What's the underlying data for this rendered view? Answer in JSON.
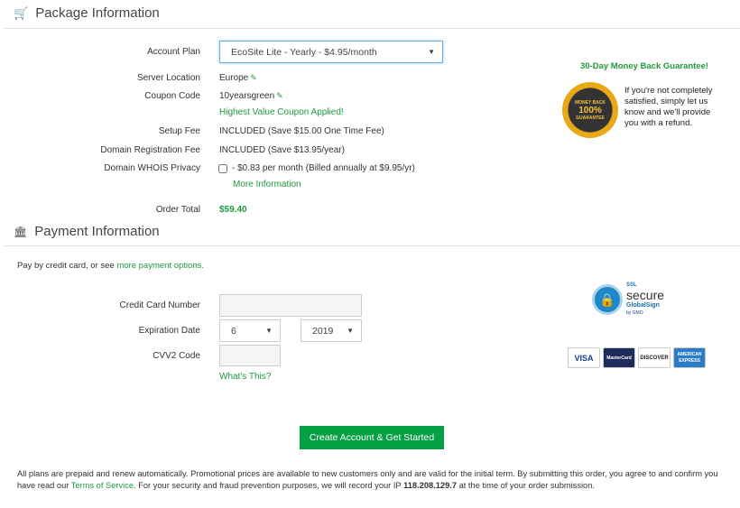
{
  "package": {
    "title": "Package Information",
    "icon": "shopping-cart-icon",
    "account_plan_label": "Account Plan",
    "account_plan_value": "EcoSite Lite - Yearly - $4.95/month",
    "server_location_label": "Server Location",
    "server_location_value": "Europe",
    "coupon_label": "Coupon Code",
    "coupon_value": "10yearsgreen",
    "coupon_message": "Highest Value Coupon Applied!",
    "setup_fee_label": "Setup Fee",
    "setup_fee_value": "INCLUDED (Save $15.00 One Time Fee)",
    "domain_reg_label": "Domain Registration Fee",
    "domain_reg_value": "INCLUDED (Save $13.95/year)",
    "whois_label": "Domain WHOIS Privacy",
    "whois_value": "- $0.83 per month (Billed annually at $9.95/yr)",
    "whois_checked": false,
    "more_info": "More Information",
    "order_total_label": "Order Total",
    "order_total_value": "$59.40"
  },
  "guarantee": {
    "title": "30-Day Money Back Guarantee!",
    "text": "If you're not completely satisfied, simply let us know and we'll provide you with a refund.",
    "badge_top": "MONEY BACK",
    "badge_mid": "100%",
    "badge_bottom": "GUARANTEE"
  },
  "payment": {
    "title": "Payment Information",
    "icon": "bank-icon",
    "intro": "Pay by credit card, or see ",
    "intro_link": "more payment options.",
    "cc_label": "Credit Card Number",
    "cc_value": "",
    "exp_label": "Expiration Date",
    "exp_month": "6",
    "exp_year": "2019",
    "cvv_label": "CVV2 Code",
    "cvv_value": "",
    "whats_this": "What's This?"
  },
  "secure": {
    "ssl": "SSL",
    "secure": "secure",
    "globalsign": "GlobalSign",
    "gmo": "by GMO"
  },
  "cards": [
    "VISA",
    "MasterCard",
    "DISCOVER",
    "AMERICAN EXPRESS"
  ],
  "submit_label": "Create Account & Get Started",
  "footer": {
    "text1": "All plans are prepaid and renew automatically. Promotional prices are available to new customers only and are valid for the initial term. By submitting this order, you agree to and confirm you have read our ",
    "tos": "Terms of Service",
    "text2": ". For your security and fraud prevention purposes, we will record your IP ",
    "ip": "118.208.129.7",
    "text3": " at the time of your order submission."
  },
  "colors": {
    "accent": "#1e9a3c",
    "button": "#05a043"
  }
}
